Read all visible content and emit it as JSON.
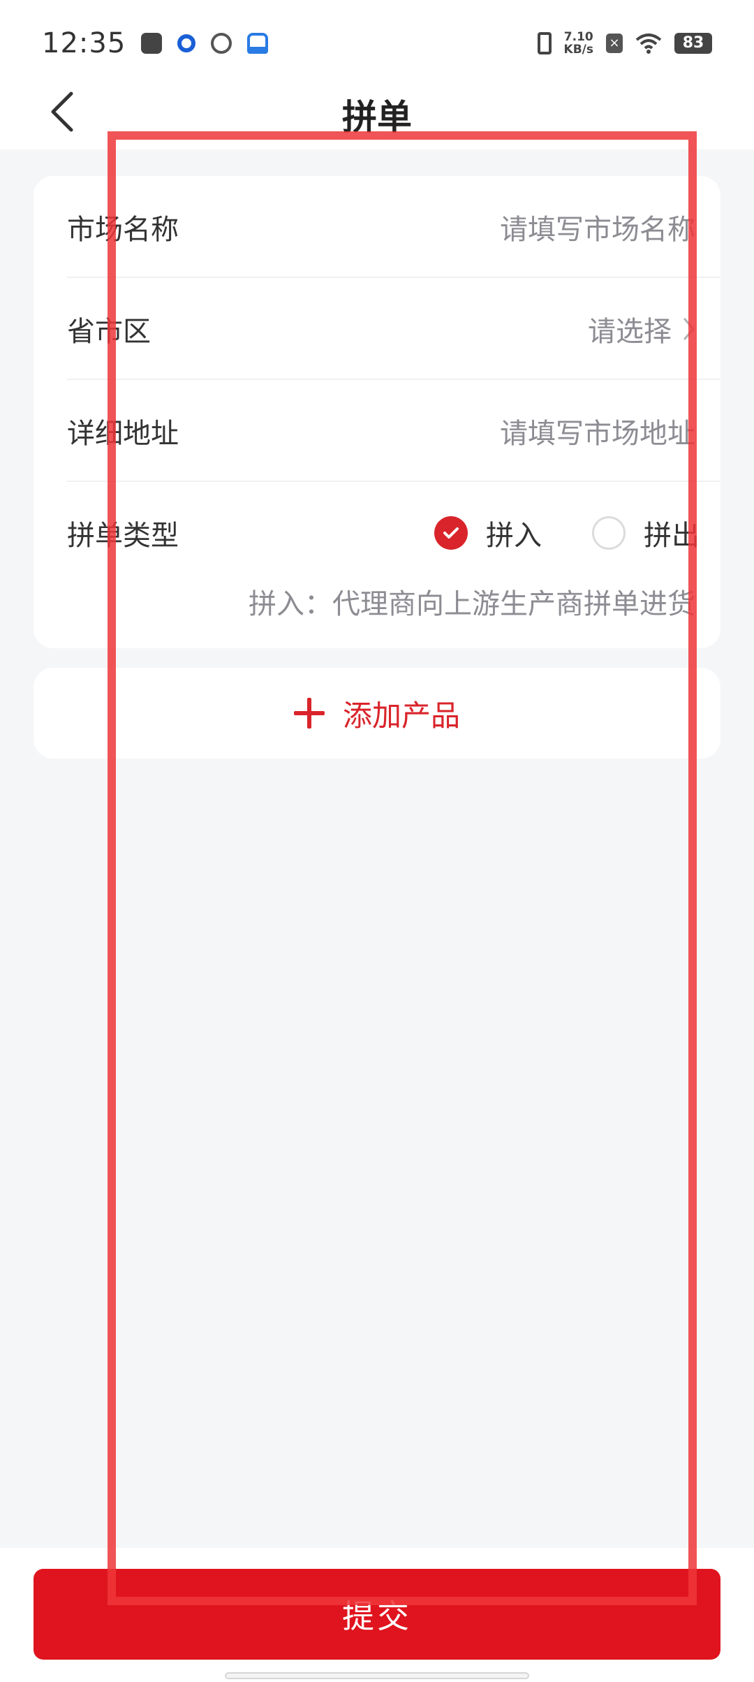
{
  "status_bar": {
    "time": "12:35",
    "net_speed_value": "7.10",
    "net_speed_unit": "KB/s",
    "battery": "83",
    "icons": [
      "message-icon",
      "circle-app-icon",
      "sync-icon",
      "lock-app-icon",
      "vibrate-icon",
      "close-box-icon",
      "wifi-icon",
      "battery-icon"
    ]
  },
  "nav": {
    "title": "拼单",
    "back_icon": "chevron-left-icon"
  },
  "form": {
    "market_name": {
      "label": "市场名称",
      "placeholder": "请填写市场名称"
    },
    "region": {
      "label": "省市区",
      "placeholder": "请选择"
    },
    "address": {
      "label": "详细地址",
      "placeholder": "请填写市场地址"
    },
    "order_type": {
      "label": "拼单类型",
      "options": [
        {
          "label": "拼入",
          "selected": true
        },
        {
          "label": "拼出",
          "selected": false
        }
      ],
      "hint": "拼入：代理商向上游生产商拼单进货"
    }
  },
  "add_product": {
    "label": "添加产品"
  },
  "submit": {
    "label": "提交"
  },
  "colors": {
    "accent": "#e0141e",
    "highlight": "#ef3638",
    "background": "#f5f6f8"
  }
}
